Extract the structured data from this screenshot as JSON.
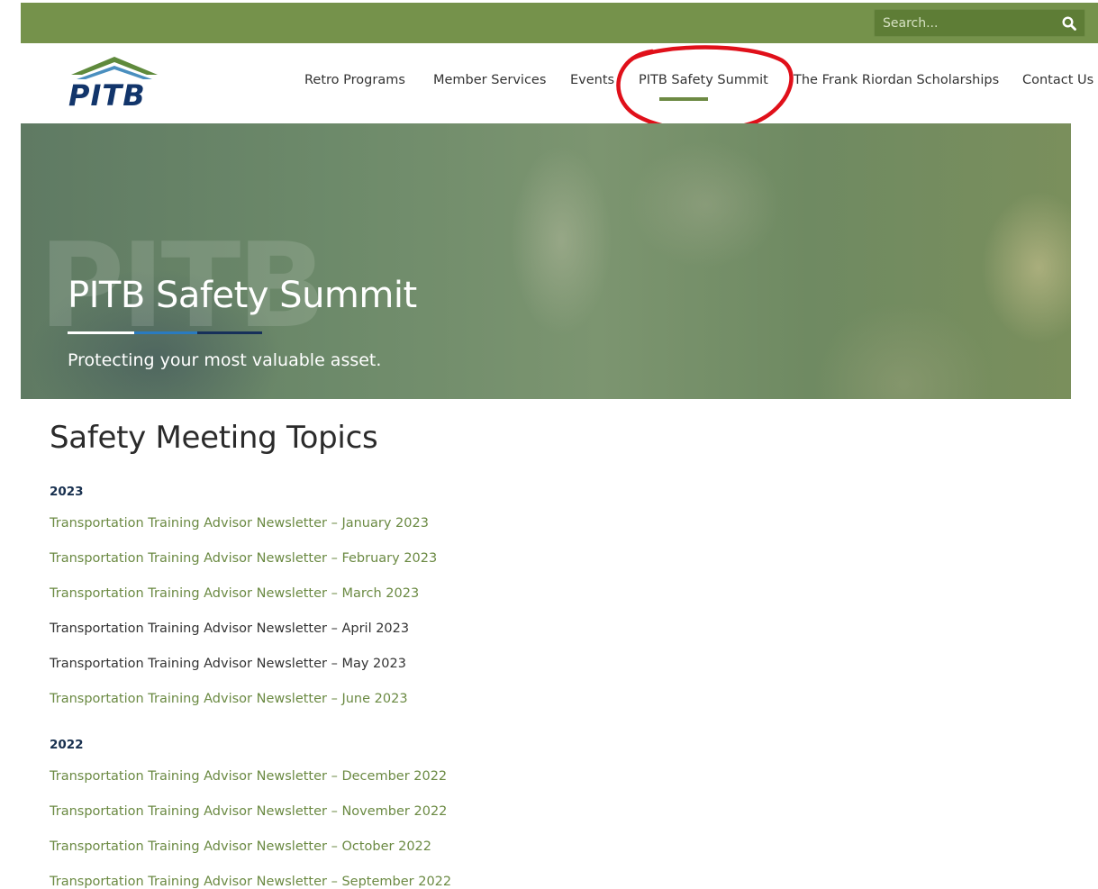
{
  "search": {
    "placeholder": "Search..."
  },
  "logo": {
    "text": "PITB"
  },
  "nav": {
    "items": [
      {
        "label": "Retro Programs"
      },
      {
        "label": "Member Services"
      },
      {
        "label": "Events"
      },
      {
        "label": "PITB Safety Summit"
      },
      {
        "label": "The Frank Riordan Scholarships"
      },
      {
        "label": "Contact Us"
      }
    ],
    "active_index": 3
  },
  "hero": {
    "watermark": "PITB",
    "title": "PITB Safety Summit",
    "subtitle": "Protecting your most valuable asset."
  },
  "content": {
    "heading": "Safety Meeting Topics",
    "years": [
      {
        "year": "2023",
        "links": [
          {
            "label": "Transportation Training Advisor Newsletter – January 2023",
            "style": "green"
          },
          {
            "label": "Transportation Training Advisor Newsletter – February 2023",
            "style": "green"
          },
          {
            "label": "Transportation Training Advisor Newsletter – March 2023",
            "style": "green"
          },
          {
            "label": "Transportation Training Advisor Newsletter – April 2023",
            "style": "dark"
          },
          {
            "label": "Transportation Training Advisor Newsletter – May 2023",
            "style": "dark"
          },
          {
            "label": "Transportation Training Advisor Newsletter – June 2023",
            "style": "green"
          }
        ]
      },
      {
        "year": "2022",
        "links": [
          {
            "label": "Transportation Training Advisor Newsletter – December 2022",
            "style": "green"
          },
          {
            "label": "Transportation Training Advisor Newsletter – November 2022",
            "style": "green"
          },
          {
            "label": "Transportation Training Advisor Newsletter – October 2022",
            "style": "green"
          },
          {
            "label": "Transportation Training Advisor Newsletter – September 2022",
            "style": "green"
          }
        ]
      }
    ]
  },
  "colors": {
    "brand_green": "#75924b",
    "link_green": "#6b8a43",
    "navy": "#12356b",
    "annotation_red": "#e0101a"
  },
  "icons": {
    "search": "search-icon",
    "logo_mark": "mountain-icon"
  }
}
